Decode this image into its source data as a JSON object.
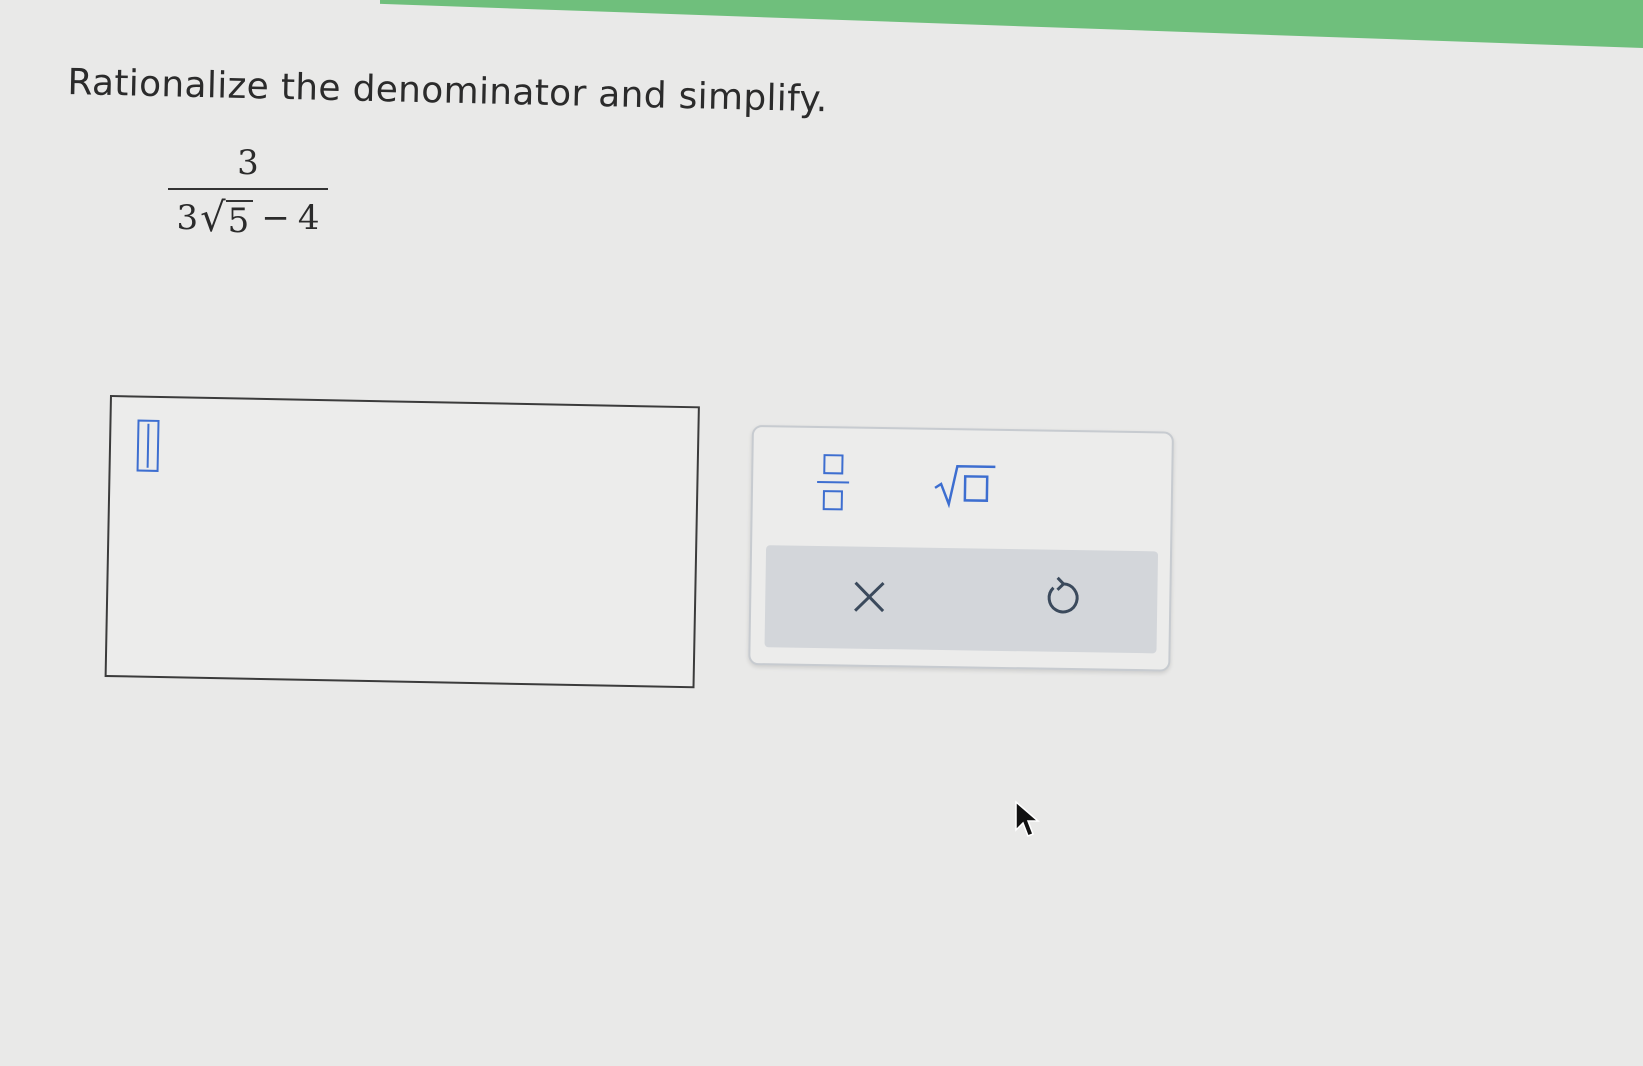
{
  "question": {
    "prompt": "Rationalize the denominator and simplify."
  },
  "expression": {
    "numerator": "3",
    "denominator_coefficient": "3",
    "radicand": "5",
    "denominator_operator": "−",
    "denominator_constant": "4"
  },
  "answer_input": {
    "value": ""
  },
  "palette": {
    "tools": [
      {
        "name": "fraction",
        "icon": "fraction-icon"
      },
      {
        "name": "square root",
        "icon": "square-root-icon"
      }
    ],
    "actions": [
      {
        "name": "clear",
        "icon": "close-icon"
      },
      {
        "name": "undo",
        "icon": "undo-icon"
      }
    ]
  },
  "colors": {
    "accent": "#3d6ed0",
    "top_bar": "#6fbf7c",
    "background": "#e9e9e8",
    "action_bar": "#d3d6da"
  }
}
